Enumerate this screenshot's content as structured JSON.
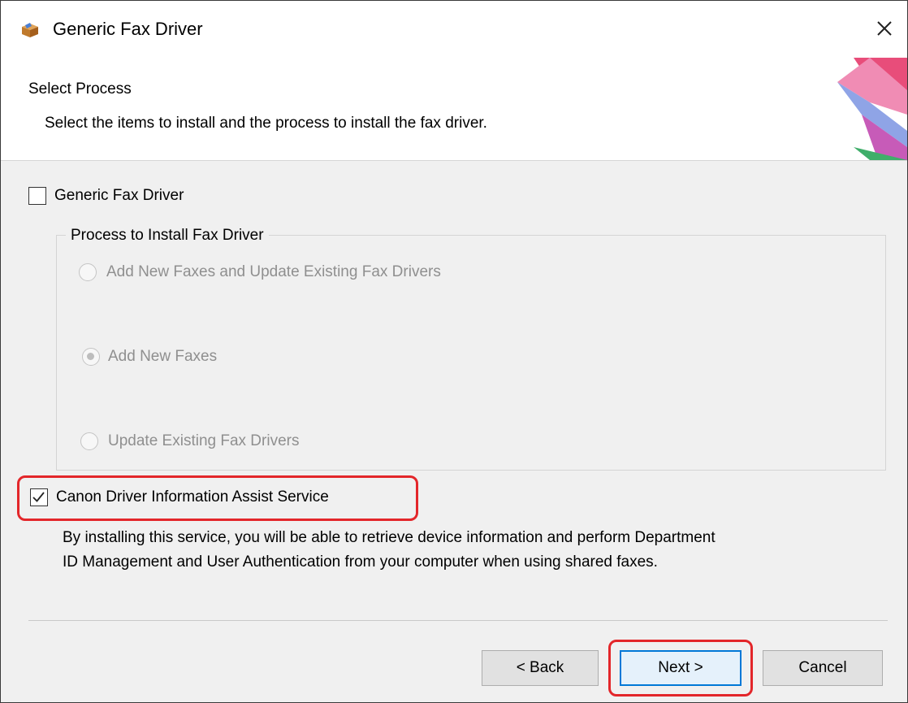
{
  "window": {
    "title": "Generic Fax Driver",
    "close_symbol": "✕"
  },
  "header": {
    "title": "Select Process",
    "subtitle": "Select the items to install and the process to install the fax driver."
  },
  "options": {
    "generic_fax_driver": {
      "label": "Generic Fax Driver",
      "checked": false
    },
    "process_group": {
      "legend": "Process to Install Fax Driver",
      "radios": [
        {
          "label": "Add New Faxes and Update Existing Fax Drivers",
          "selected": false,
          "enabled": false
        },
        {
          "label": "Add New Faxes",
          "selected": true,
          "enabled": false
        },
        {
          "label": "Update Existing Fax Drivers",
          "selected": false,
          "enabled": false
        }
      ]
    },
    "assist_service": {
      "label": "Canon Driver Information Assist Service",
      "checked": true,
      "description_line1": "By installing this service, you will be able to retrieve device information and perform Department",
      "description_line2": "ID Management and User Authentication from your computer when using shared faxes."
    }
  },
  "buttons": {
    "back": "< Back",
    "next": "Next >",
    "cancel": "Cancel"
  },
  "colors": {
    "highlight": "#e3262a",
    "default_button_border": "#0078d7"
  }
}
